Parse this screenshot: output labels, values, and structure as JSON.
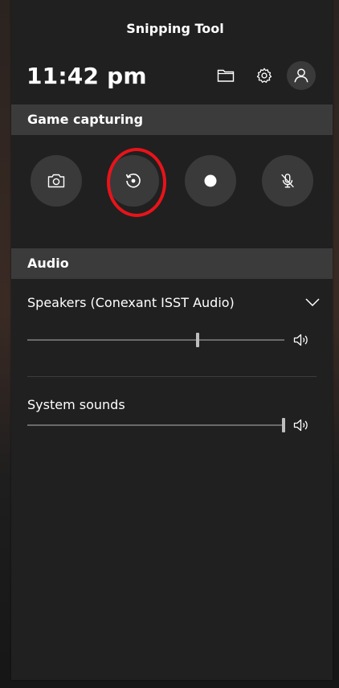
{
  "window": {
    "title": "Snipping Tool"
  },
  "header": {
    "time": "11:42 pm",
    "icons": [
      "folder-icon",
      "gear-icon",
      "user-icon"
    ]
  },
  "game_capturing": {
    "heading": "Game capturing",
    "buttons": [
      {
        "icon": "camera-icon"
      },
      {
        "icon": "recent-capture-icon",
        "highlighted": true
      },
      {
        "icon": "record-dot-icon"
      },
      {
        "icon": "mic-off-icon"
      }
    ],
    "highlight_color": "#e8131a"
  },
  "audio": {
    "heading": "Audio",
    "device": {
      "label": "Speakers (Conexant ISST Audio)",
      "icon": "chevron-down-icon",
      "volume_fraction": 0.66
    },
    "system_sounds": {
      "label": "System sounds",
      "volume_fraction": 1.0
    }
  },
  "colors": {
    "panel_bg": "#202020",
    "section_bar": "#3b3b3b",
    "button_bg": "#3a3a3a",
    "text": "#ffffff"
  }
}
